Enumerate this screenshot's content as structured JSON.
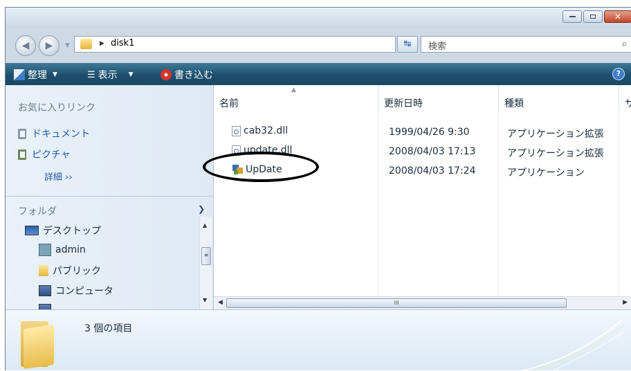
{
  "window": {
    "title_buttons": [
      "minimize",
      "maximize",
      "close"
    ]
  },
  "address": {
    "path": "disk1",
    "search_placeholder": "検索"
  },
  "toolbar": {
    "organize_label": "整理",
    "views_label": "表示",
    "burn_label": "書き込む"
  },
  "nav": {
    "favorites_heading": "お気に入りリンク",
    "links": [
      {
        "label": "ドキュメント",
        "icon": "document-icon"
      },
      {
        "label": "ピクチャ",
        "icon": "pictures-icon"
      }
    ],
    "more_label": "詳細 ››",
    "folders_heading": "フォルダ",
    "tree": [
      {
        "label": "デスクトップ",
        "icon": "desktop-icon"
      },
      {
        "label": "admin",
        "icon": "user-folder-icon"
      },
      {
        "label": "パブリック",
        "icon": "folder-icon"
      },
      {
        "label": "コンピュータ",
        "icon": "computer-icon"
      }
    ]
  },
  "files": {
    "columns": [
      "名前",
      "更新日時",
      "種類",
      "サ"
    ],
    "rows": [
      {
        "name": "cab32.dll",
        "modified": "1999/04/26 9:30",
        "type": "アプリケーション拡張",
        "icon": "dll-icon"
      },
      {
        "name": "update.dll",
        "modified": "2008/04/03 17:13",
        "type": "アプリケーション拡張",
        "icon": "dll-icon"
      },
      {
        "name": "UpDate",
        "modified": "2008/04/03 17:24",
        "type": "アプリケーション",
        "icon": "application-icon"
      }
    ],
    "hscroll_grip": "III"
  },
  "details": {
    "item_count": "3 個の項目"
  },
  "colors": {
    "toolbar": "#1d4f6d",
    "link": "#1f5aa8",
    "annotation": "#000000"
  }
}
